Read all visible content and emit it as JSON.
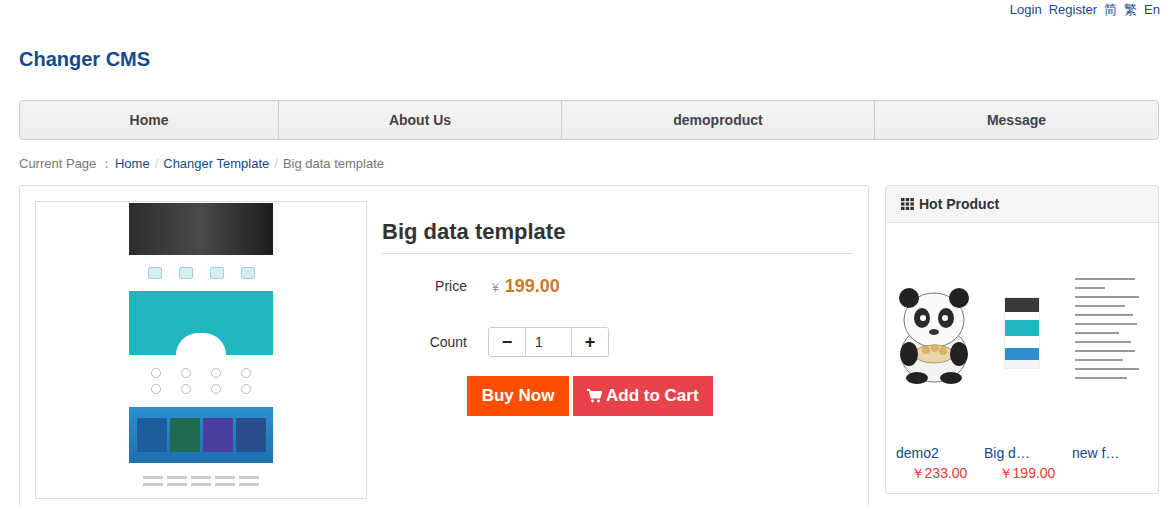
{
  "top_links": [
    "Login",
    "Register",
    "简",
    "繁",
    "En"
  ],
  "site_title": "Changer CMS",
  "nav": [
    "Home",
    "About Us",
    "demoproduct",
    "Message"
  ],
  "breadcrumb": {
    "label": "Current Page ：",
    "separator": "/",
    "items": [
      {
        "label": "Home",
        "current": false
      },
      {
        "label": "Changer Template",
        "current": false
      },
      {
        "label": "Big data template",
        "current": true
      }
    ]
  },
  "product": {
    "title": "Big data template",
    "price_label": "Price",
    "currency": "¥",
    "price": "199.00",
    "count_label": "Count",
    "minus": "−",
    "plus": "+",
    "count": "1",
    "buy_now": "Buy Now",
    "add_to_cart": "Add to Cart"
  },
  "sidebar": {
    "title": "Hot Product",
    "products": [
      {
        "name": "demo2",
        "price": "￥233.00",
        "kind": "photo"
      },
      {
        "name": "Big d…",
        "price": "￥199.00",
        "kind": "webpage"
      },
      {
        "name": "new f…",
        "kind": "document"
      }
    ]
  }
}
